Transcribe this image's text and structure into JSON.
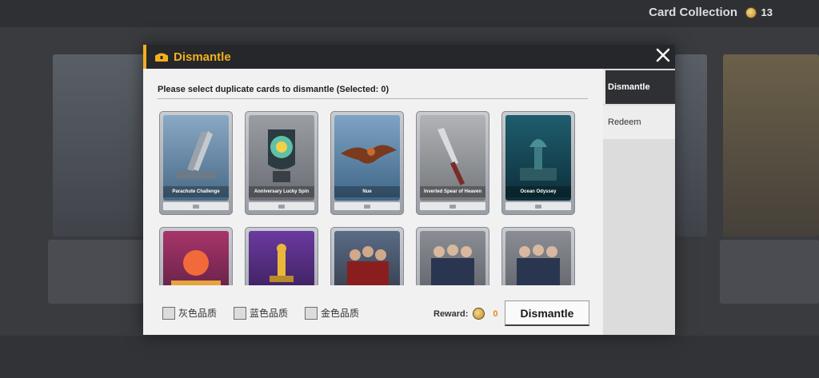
{
  "modal": {
    "title": "Dismantle",
    "instruction": "Please select duplicate cards to dismantle (Selected: 0)"
  },
  "tabs": [
    {
      "label": "Dismantle",
      "active": true
    },
    {
      "label": "Redeem",
      "active": false
    }
  ],
  "cards_row1": [
    {
      "name": "Parachute Challenge"
    },
    {
      "name": "Anniversary Lucky Spin"
    },
    {
      "name": "Nue"
    },
    {
      "name": "Inverted Spear of Heaven"
    },
    {
      "name": "Ocean Odyssey"
    }
  ],
  "filters": [
    {
      "label": "灰色品质",
      "checked": false
    },
    {
      "label": "蓝色品质",
      "checked": false
    },
    {
      "label": "金色品质",
      "checked": false
    }
  ],
  "reward": {
    "label": "Reward:",
    "value": "0"
  },
  "dismantle_button": "Dismantle",
  "topbar": {
    "title": "Card Collection",
    "coins": "13"
  },
  "colors": {
    "accent": "#f2b01e",
    "reward": "#e7881b",
    "header": "#26272b"
  }
}
